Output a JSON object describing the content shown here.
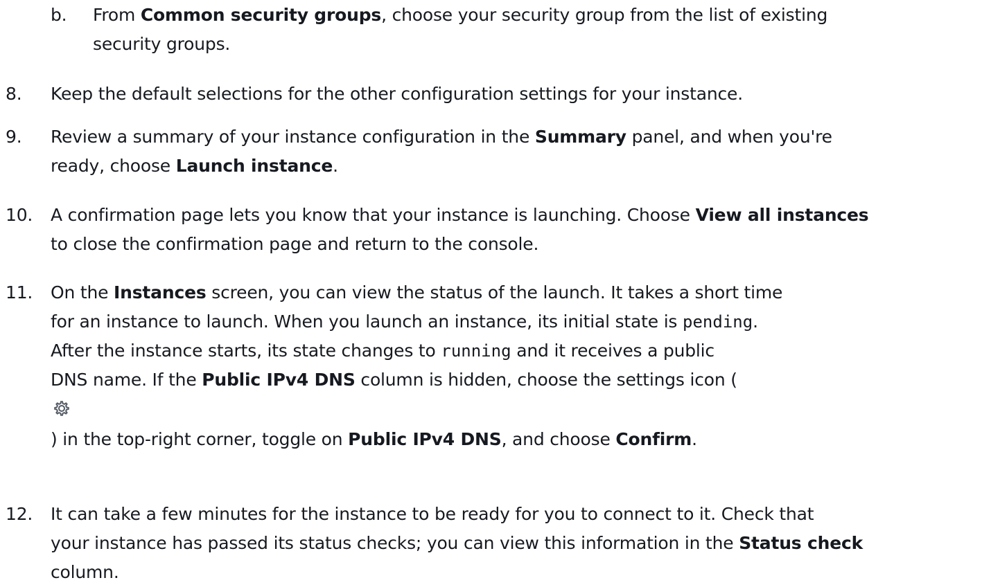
{
  "steps": {
    "b": {
      "marker": "b.",
      "l1_pre": "From ",
      "l1_bold": "Common security groups",
      "l1_post": ", choose your security group from the list of existing",
      "l2": "security groups."
    },
    "s8": {
      "marker": "8.",
      "text": "Keep the default selections for the other configuration settings for your instance."
    },
    "s9": {
      "marker": "9.",
      "l1_pre": "Review a summary of your instance configuration in the ",
      "l1_bold": "Summary",
      "l1_post": " panel, and when you're",
      "l2_pre": "ready, choose ",
      "l2_bold": "Launch instance",
      "l2_post": "."
    },
    "s10": {
      "marker": "10.",
      "l1_pre": "A confirmation page lets you know that your instance is launching. Choose ",
      "l1_bold": "View all instances",
      "l2": "to close the confirmation page and return to the console."
    },
    "s11": {
      "marker": "11.",
      "l1_pre": "On the ",
      "l1_bold": "Instances",
      "l1_post": " screen, you can view the status of the launch. It takes a short time",
      "l2_pre": "for an instance to launch. When you launch an instance, its initial state is ",
      "l2_code": "pending",
      "l2_post": ".",
      "l3_pre": "After the instance starts, its state changes to ",
      "l3_code": "running",
      "l3_post": " and it receives a public",
      "l4_pre": "DNS name. If the ",
      "l4_bold": "Public IPv4 DNS",
      "l4_post": " column is hidden, choose the settings icon (",
      "icon": "settings-gear-icon",
      "l6_pre": ") in the top-right corner, toggle on ",
      "l6_bold1": "Public IPv4 DNS",
      "l6_mid": ", and choose ",
      "l6_bold2": "Confirm",
      "l6_post": "."
    },
    "s12": {
      "marker": "12.",
      "l1": "It can take a few minutes for the instance to be ready for you to connect to it. Check that",
      "l2_pre": "your instance has passed its status checks; you can view this information in the ",
      "l2_bold": "Status check",
      "l3": "column."
    }
  },
  "colors": {
    "text": "#16191f",
    "icon": "#545b64"
  }
}
